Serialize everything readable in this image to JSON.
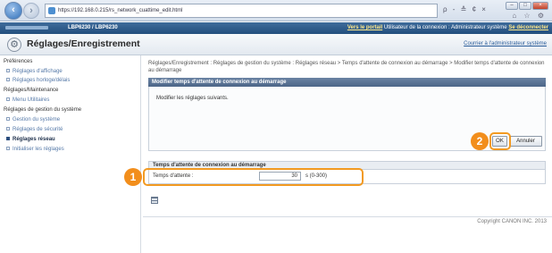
{
  "browser": {
    "url": "https://192.168.0.215/rs_network_cuattime_edit.html",
    "tools": "ρ - ≙ ¢ ×",
    "right_icons": "⌂ ☆ ⚙"
  },
  "header": {
    "model": "LBP6230 / LBP6230",
    "portal_link": "Vers le portail",
    "user_text": "Utilisateur de la connexion : Administrateur système",
    "logout_link": "Se déconnecter"
  },
  "title_bar": {
    "title": "Réglages/Enregistrement",
    "mail_link": "Courrier à l'administrateur système"
  },
  "sidebar": {
    "preferences_heading": "Préférences",
    "pref_items": [
      "Réglages d'affichage",
      "Réglages horloge/délais"
    ],
    "maintenance_heading": "Réglages/Maintenance",
    "maint_items": [
      "Menu Utilitaires"
    ],
    "system_heading": "Réglages de gestion du système",
    "system_items": [
      "Gestion du système",
      "Réglages de sécurité",
      "Réglages réseau",
      "Initialiser les réglages"
    ]
  },
  "breadcrumb": "Réglages/Enregistrement : Réglages de gestion du système : Réglages réseau > Temps d'attente de connexion au démarrage > Modifier temps d'attente de connexion au démarrage",
  "panel": {
    "title": "Modifier temps d'attente de connexion au démarrage",
    "message": "Modifier les réglages suivants.",
    "ok_label": "OK",
    "cancel_label": "Annuler"
  },
  "section": {
    "title": "Temps d'attente de connexion au démarrage",
    "field_label": "Temps d'attente :",
    "field_value": "30",
    "field_unit": "s (0-300)"
  },
  "callouts": [
    "1",
    "2"
  ],
  "footer": {
    "copyright": "Copyright CANON INC. 2013"
  },
  "colors": {
    "callout": "#f28e1c",
    "header": "#234e7d",
    "panel_head": "#4c6688"
  }
}
